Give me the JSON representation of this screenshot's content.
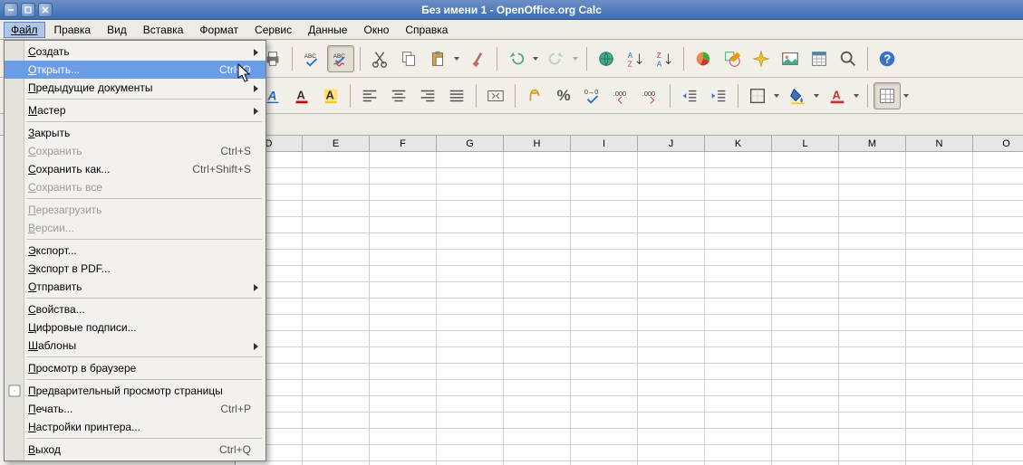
{
  "window": {
    "title": "Без имени 1 - OpenOffice.org Calc"
  },
  "menubar": [
    "Файл",
    "Правка",
    "Вид",
    "Вставка",
    "Формат",
    "Сервис",
    "Данные",
    "Окно",
    "Справка"
  ],
  "file_menu": [
    {
      "label": "Создать",
      "submenu": true
    },
    {
      "label": "Открыть...",
      "accel": "Ctrl+O",
      "highlighted": true
    },
    {
      "label": "Предыдущие документы",
      "submenu": true
    },
    {
      "sep": true
    },
    {
      "label": "Мастер",
      "submenu": true
    },
    {
      "sep": true
    },
    {
      "label": "Закрыть"
    },
    {
      "label": "Сохранить",
      "accel": "Ctrl+S",
      "disabled": true
    },
    {
      "label": "Сохранить как...",
      "accel": "Ctrl+Shift+S"
    },
    {
      "label": "Сохранить все",
      "disabled": true
    },
    {
      "sep": true
    },
    {
      "label": "Перезагрузить",
      "disabled": true
    },
    {
      "label": "Версии...",
      "disabled": true
    },
    {
      "sep": true
    },
    {
      "label": "Экспорт..."
    },
    {
      "label": "Экспорт в PDF..."
    },
    {
      "label": "Отправить",
      "submenu": true
    },
    {
      "sep": true
    },
    {
      "label": "Свойства..."
    },
    {
      "label": "Цифровые подписи..."
    },
    {
      "label": "Шаблоны",
      "submenu": true
    },
    {
      "sep": true
    },
    {
      "label": "Просмотр в браузере"
    },
    {
      "sep": true
    },
    {
      "label": "Предварительный просмотр страницы",
      "checkbox": true
    },
    {
      "label": "Печать...",
      "accel": "Ctrl+P"
    },
    {
      "label": "Настройки принтера..."
    },
    {
      "sep": true
    },
    {
      "label": "Выход",
      "accel": "Ctrl+Q"
    }
  ],
  "columns": [
    "D",
    "E",
    "F",
    "G",
    "H",
    "I",
    "J",
    "K",
    "L",
    "M",
    "N",
    "O"
  ],
  "toolbar_icons": {
    "a_under": "A",
    "abc": "ABC",
    "percent": "%"
  }
}
